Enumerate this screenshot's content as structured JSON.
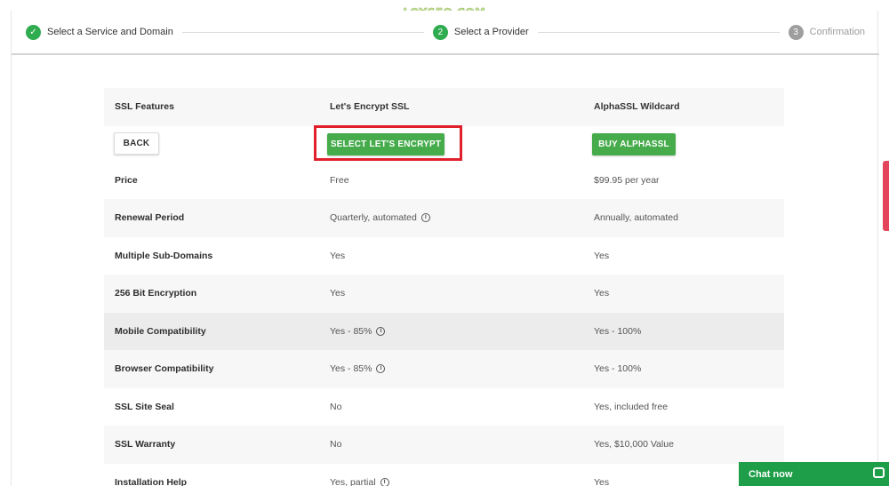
{
  "watermark": "LOYSEO.COM",
  "stepper": {
    "steps": [
      {
        "label": "Select a Service and Domain",
        "state": "done",
        "number": "✓"
      },
      {
        "label": "Select a Provider",
        "state": "active",
        "number": "2"
      },
      {
        "label": "Confirmation",
        "state": "pending",
        "number": "3"
      }
    ]
  },
  "table": {
    "header": {
      "feature": "SSL Features",
      "provider_a": "Let's Encrypt SSL",
      "provider_b": "AlphaSSL Wildcard"
    },
    "buttons": {
      "back": "BACK",
      "select_a": "SELECT LET'S ENCRYPT",
      "select_b": "BUY ALPHASSL"
    },
    "rows": [
      {
        "feature": "Price",
        "a": "Free",
        "b": "$99.95 per year",
        "a_info": false
      },
      {
        "feature": "Renewal Period",
        "a": "Quarterly, automated",
        "b": "Annually, automated",
        "a_info": true
      },
      {
        "feature": "Multiple Sub-Domains",
        "a": "Yes",
        "b": "Yes",
        "a_info": false
      },
      {
        "feature": "256 Bit Encryption",
        "a": "Yes",
        "b": "Yes",
        "a_info": false
      },
      {
        "feature": "Mobile Compatibility",
        "a": "Yes - 85%",
        "b": "Yes - 100%",
        "a_info": true
      },
      {
        "feature": "Browser Compatibility",
        "a": "Yes - 85%",
        "b": "Yes - 100%",
        "a_info": true
      },
      {
        "feature": "SSL Site Seal",
        "a": "No",
        "b": "Yes, included free",
        "a_info": false
      },
      {
        "feature": "SSL Warranty",
        "a": "No",
        "b": "Yes, $10,000 Value",
        "a_info": false
      },
      {
        "feature": "Installation Help",
        "a": "Yes, partial",
        "b": "Yes",
        "a_info": true
      }
    ]
  },
  "chat": {
    "label": "Chat now"
  },
  "colors": {
    "accent": "#45ab4b",
    "highlight": "#e0202a",
    "chat": "#1e9e48"
  }
}
